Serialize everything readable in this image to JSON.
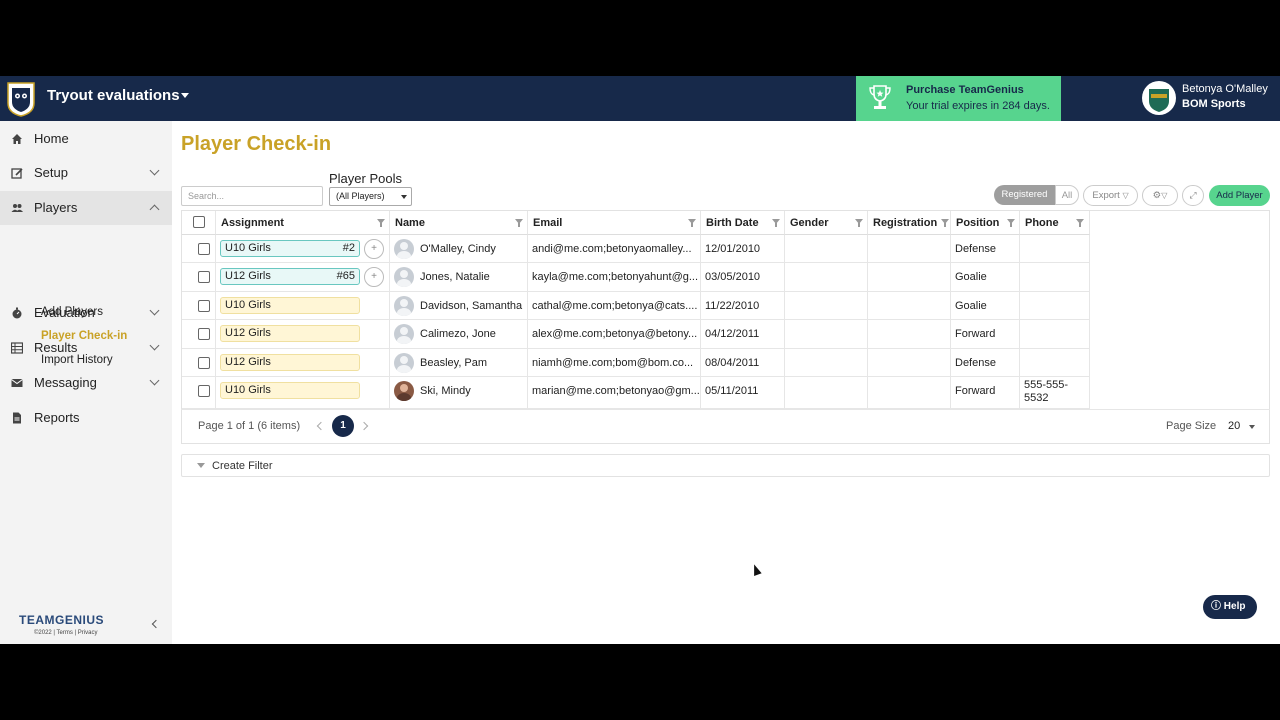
{
  "app": {
    "title": "Tryout evaluations"
  },
  "promo": {
    "title": "Purchase TeamGenius",
    "subtitle": "Your trial expires in 284 days."
  },
  "user": {
    "name": "Betonya O'Malley",
    "org": "BOM Sports"
  },
  "sidebar": {
    "items": [
      {
        "label": "Home",
        "icon": "home-icon"
      },
      {
        "label": "Setup",
        "icon": "edit-icon"
      },
      {
        "label": "Players",
        "icon": "users-icon"
      },
      {
        "label": "Evaluation",
        "icon": "stopwatch-icon"
      },
      {
        "label": "Results",
        "icon": "table-icon"
      },
      {
        "label": "Messaging",
        "icon": "envelope-icon"
      },
      {
        "label": "Reports",
        "icon": "document-icon"
      }
    ],
    "sub_items": [
      "Add Players",
      "Player Check-in",
      "Import History"
    ],
    "footer": {
      "brand": "TEAMGENIUS",
      "legal": "©2022 | Terms | Privacy"
    }
  },
  "page": {
    "title": "Player Check-in",
    "search_placeholder": "Search...",
    "pools_label": "Player Pools",
    "pools_selected": "(All Players)",
    "toggle": {
      "registered": "Registered",
      "all": "All"
    },
    "export_label": "Export",
    "add_player_label": "Add Player"
  },
  "table": {
    "columns": [
      "Assignment",
      "Name",
      "Email",
      "Birth Date",
      "Gender",
      "Registration",
      "Position",
      "Phone"
    ],
    "rows": [
      {
        "assignment": "U10 Girls",
        "number": "#2",
        "style": "teal",
        "name": "O'Malley, Cindy",
        "email": "andi@me.com;betonyaomalley...",
        "birth": "12/01/2010",
        "gender": "",
        "registration": "",
        "position": "Defense",
        "phone": ""
      },
      {
        "assignment": "U12 Girls",
        "number": "#65",
        "style": "teal",
        "name": "Jones, Natalie",
        "email": "kayla@me.com;betonyahunt@g...",
        "birth": "03/05/2010",
        "gender": "",
        "registration": "",
        "position": "Goalie",
        "phone": ""
      },
      {
        "assignment": "U10 Girls",
        "number": "",
        "style": "cream",
        "name": "Davidson, Samantha",
        "email": "cathal@me.com;betonya@cats....",
        "birth": "11/22/2010",
        "gender": "",
        "registration": "",
        "position": "Goalie",
        "phone": ""
      },
      {
        "assignment": "U12 Girls",
        "number": "",
        "style": "cream",
        "name": "Calimezo, Jone",
        "email": "alex@me.com;betonya@betony...",
        "birth": "04/12/2011",
        "gender": "",
        "registration": "",
        "position": "Forward",
        "phone": ""
      },
      {
        "assignment": "U12 Girls",
        "number": "",
        "style": "cream",
        "name": "Beasley, Pam",
        "email": "niamh@me.com;bom@bom.co...",
        "birth": "08/04/2011",
        "gender": "",
        "registration": "",
        "position": "Defense",
        "phone": ""
      },
      {
        "assignment": "U10 Girls",
        "number": "",
        "style": "cream",
        "name": "Ski, Mindy",
        "email": "marian@me.com;betonyao@gm...",
        "birth": "05/11/2011",
        "gender": "",
        "registration": "",
        "position": "Forward",
        "phone": "555-555-5532"
      }
    ]
  },
  "pager": {
    "summary": "Page 1 of 1 (6 items)",
    "current": "1",
    "page_size_label": "Page Size",
    "page_size": "20"
  },
  "filter": {
    "label": "Create Filter"
  },
  "help": {
    "label": "Help"
  },
  "colors": {
    "navy": "#17294a",
    "gold": "#c9a227",
    "green": "#57d48e"
  }
}
